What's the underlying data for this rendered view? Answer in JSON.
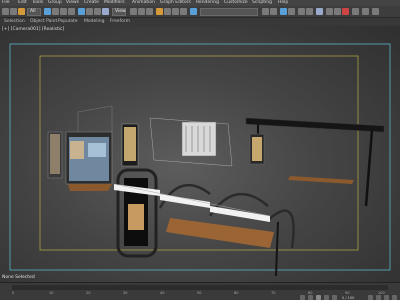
{
  "menu": {
    "items": [
      "File",
      "Edit",
      "Tools",
      "Group",
      "Views",
      "Create",
      "Modifiers",
      "Animation",
      "Graph Editors",
      "Rendering",
      "Customize",
      "Scripting",
      "Help"
    ]
  },
  "toolbar": {
    "selection_filter": "All",
    "reference_coord": "View",
    "named_selection": ""
  },
  "ribbon": {
    "items": [
      "Selection",
      "Object Paint",
      "Populate",
      "Modeling",
      "Freeform"
    ]
  },
  "viewport": {
    "label": "[+] [Camera001] [Realistic]",
    "status": "None Selected"
  },
  "timeline": {
    "labels": [
      "0",
      "10",
      "20",
      "30",
      "40",
      "50",
      "60",
      "70",
      "80",
      "90",
      "100"
    ],
    "frame_counter": "0 / 100"
  }
}
